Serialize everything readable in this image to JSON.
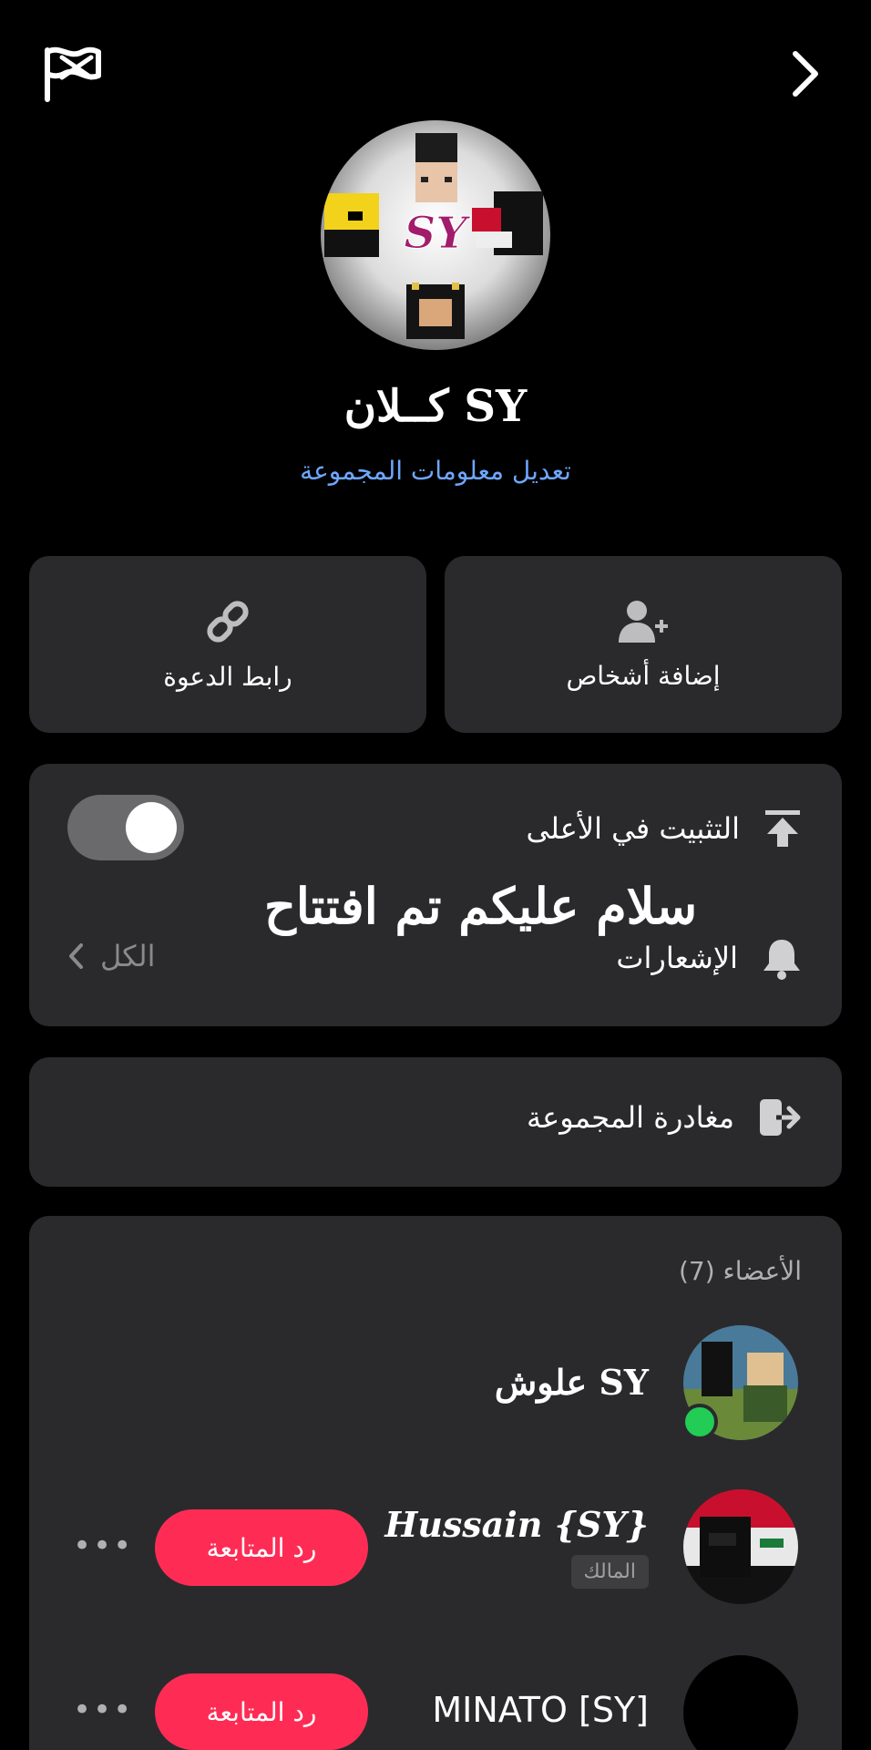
{
  "header": {
    "back_icon": "chevron-right-icon",
    "report_icon": "flag-icon"
  },
  "group": {
    "avatar_text": "SY",
    "title": "كــلان SY",
    "edit_link": "تعديل معلومات المجموعة"
  },
  "actions": {
    "add_people": {
      "label": "إضافة أشخاص",
      "icon": "add-user-icon"
    },
    "invite_link": {
      "label": "رابط الدعوة",
      "icon": "link-icon"
    }
  },
  "settings": {
    "pin_label": "التثبيت في الأعلى",
    "pin_enabled": true,
    "notifications_label": "الإشعارات",
    "notifications_value": "الكل"
  },
  "overlay_text": "سلام عليكم تم افتتاح",
  "leave": {
    "label": "مغادرة المجموعة"
  },
  "members": {
    "header": "الأعضاء (7)",
    "list": [
      {
        "name": "علوش SY",
        "online": true
      },
      {
        "name": "Hussain {SY}",
        "badge": "المالك",
        "follow_label": "رد المتابعة",
        "more": "•••"
      },
      {
        "name": "MINATO [SY]",
        "follow_label": "رد المتابعة",
        "more": "•••"
      }
    ]
  },
  "colors": {
    "accent": "#fe2c55",
    "link": "#6ea7ff",
    "card": "#2a2a2c",
    "online": "#22cc55"
  }
}
